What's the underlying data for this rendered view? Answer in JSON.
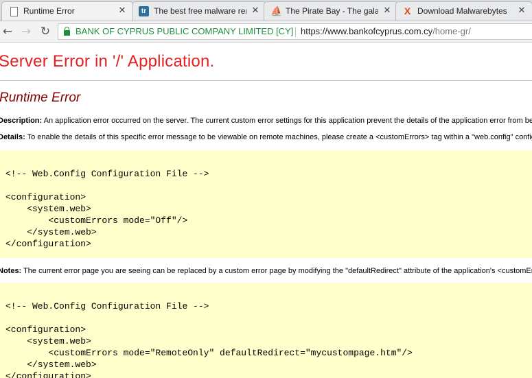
{
  "tabs": [
    {
      "title": "Runtime Error",
      "favicon": "document-icon",
      "active": true
    },
    {
      "title": "The best free malware removal",
      "favicon": "tr-icon",
      "active": false
    },
    {
      "title": "The Pirate Bay - The galaxy's",
      "favicon": "pirate-ship-icon",
      "active": false
    },
    {
      "title": "Download Malwarebytes",
      "favicon": "malwarebytes-icon",
      "active": false
    }
  ],
  "toolbar": {
    "back": "←",
    "forward": "→",
    "reload": "↻"
  },
  "address": {
    "ev_label": "BANK OF CYPRUS PUBLIC COMPANY LIMITED [CY]",
    "url_host": "https://www.bankofcyprus.com.cy",
    "url_path": "/home-gr/",
    "ev_color": "#1e8e3e"
  },
  "error": {
    "title": "Server Error in '/' Application.",
    "subtitle": "Runtime Error",
    "description_label": "Description:",
    "description_text": " An application error occurred on the server. The current custom error settings for this application prevent the details of the application error from being viewed remotely (for security reasons).",
    "details_label": "Details:",
    "details_text": " To enable the details of this specific error message to be viewable on remote machines, please create a <customErrors> tag within a \"web.config\" configuration file located in the root directory of the current web application.",
    "code1": "<!-- Web.Config Configuration File -->\n\n<configuration>\n    <system.web>\n        <customErrors mode=\"Off\"/>\n    </system.web>\n</configuration>",
    "notes_label": "Notes:",
    "notes_text": " The current error page you are seeing can be replaced by a custom error page by modifying the \"defaultRedirect\" attribute of the application's <customErrors> configuration tag to point to a custom error page URL.",
    "code2": "<!-- Web.Config Configuration File -->\n\n<configuration>\n    <system.web>\n        <customErrors mode=\"RemoteOnly\" defaultRedirect=\"mycustompage.htm\"/>\n    </system.web>\n</configuration>"
  }
}
